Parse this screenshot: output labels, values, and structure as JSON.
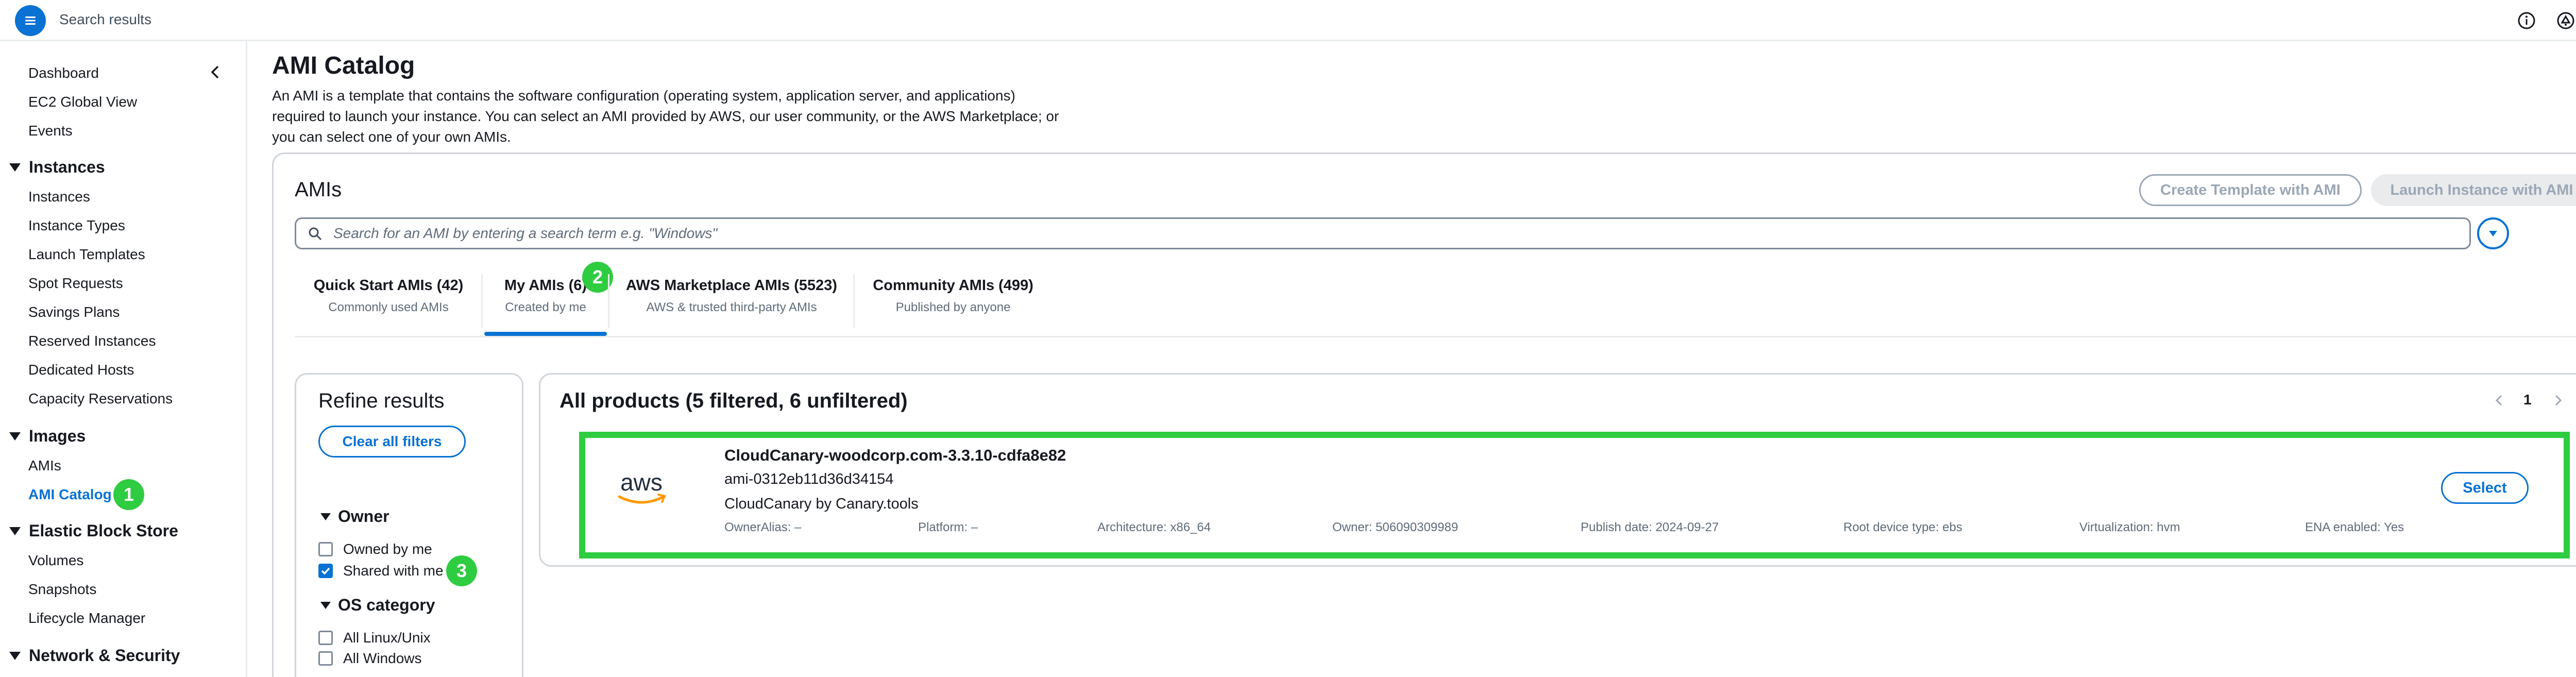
{
  "topbar": {
    "title": "Search results",
    "menu_icon": "hamburger-menu-icon",
    "icons": [
      "info-icon",
      "notifications-icon",
      "feedback-icon"
    ]
  },
  "sidebar": {
    "collapse_icon": "chevron-left-icon",
    "top_links": [
      "Dashboard",
      "EC2 Global View",
      "Events"
    ],
    "sections": [
      {
        "title": "Instances",
        "items": [
          "Instances",
          "Instance Types",
          "Launch Templates",
          "Spot Requests",
          "Savings Plans",
          "Reserved Instances",
          "Dedicated Hosts",
          "Capacity Reservations"
        ]
      },
      {
        "title": "Images",
        "items": [
          "AMIs",
          "AMI Catalog"
        ]
      },
      {
        "title": "Elastic Block Store",
        "items": [
          "Volumes",
          "Snapshots",
          "Lifecycle Manager"
        ]
      },
      {
        "title": "Network & Security",
        "items": []
      }
    ],
    "active_item": "AMI Catalog"
  },
  "annotations": {
    "badge1": "1",
    "badge2": "2",
    "badge3": "3",
    "color": "#2ecc40"
  },
  "page": {
    "title": "AMI Catalog",
    "description_line1": "An AMI is a template that contains the software configuration (operating system, application server, and applications)",
    "description_line2": "required to launch your instance. You can select an AMI provided by AWS, our user community, or the AWS Marketplace; or",
    "description_line3": "you can select one of your own AMIs."
  },
  "amis": {
    "heading": "AMIs",
    "create_template_button": "Create Template with AMI",
    "launch_instance_button": "Launch Instance with AMI",
    "search_placeholder": "Search for an AMI by entering a search term e.g. \"Windows\"",
    "tabs": [
      {
        "label": "Quick Start AMIs (42)",
        "sub": "Commonly used AMIs"
      },
      {
        "label": "My AMIs (6)",
        "sub": "Created by me",
        "selected": true
      },
      {
        "label": "AWS Marketplace AMIs (5523)",
        "sub": "AWS & trusted third-party AMIs"
      },
      {
        "label": "Community AMIs (499)",
        "sub": "Published by anyone"
      }
    ]
  },
  "refine": {
    "title": "Refine results",
    "clear_button": "Clear all filters",
    "owner_heading": "Owner",
    "owner_options": [
      {
        "label": "Owned by me",
        "checked": false
      },
      {
        "label": "Shared with me",
        "checked": true
      }
    ],
    "os_heading": "OS category",
    "os_options": [
      {
        "label": "All Linux/Unix",
        "checked": false
      },
      {
        "label": "All Windows",
        "checked": false
      }
    ]
  },
  "results": {
    "title": "All products (5 filtered, 6 unfiltered)",
    "page_number": "1",
    "item": {
      "logo_text": "aws",
      "name": "CloudCanary-woodcorp.com-3.3.10-cdfa8e82",
      "ami_id": "ami-0312eb11d36d34154",
      "provider": "CloudCanary by Canary.tools",
      "owner_alias": "OwnerAlias: –",
      "platform": "Platform: –",
      "architecture": "Architecture: x86_64",
      "owner": "Owner: 506090309989",
      "publish_date": "Publish date: 2024-09-27",
      "root_device": "Root device type: ebs",
      "virtualization": "Virtualization: hvm",
      "ena": "ENA enabled: Yes",
      "select_button": "Select"
    }
  },
  "colors": {
    "accent": "#0972d3",
    "highlight": "#2ecc40",
    "text": "#16191f",
    "muted": "#5f6b7a"
  }
}
